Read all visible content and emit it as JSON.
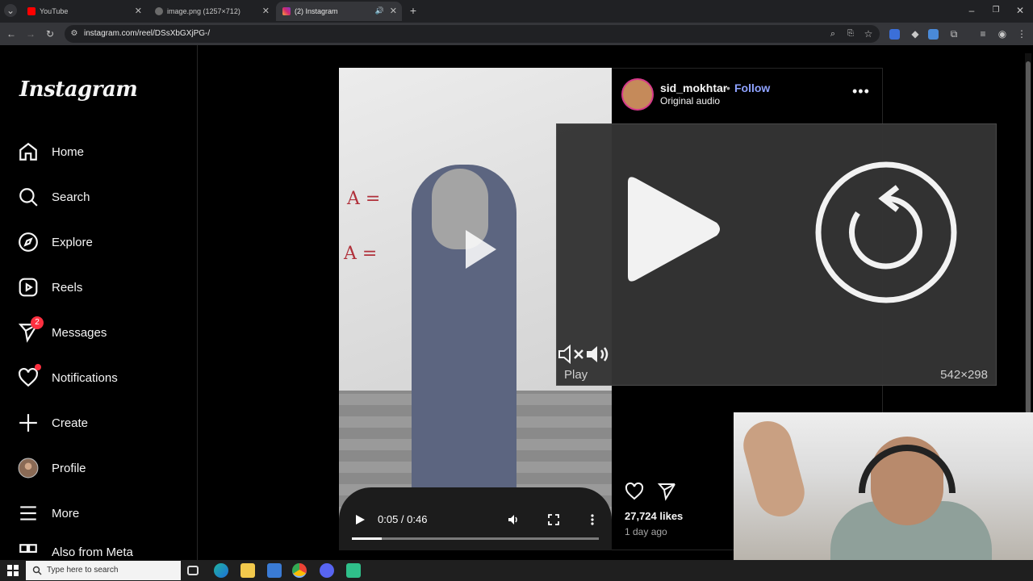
{
  "browser": {
    "tabs": [
      {
        "title": "YouTube",
        "active": false
      },
      {
        "title": "image.png (1257×712)",
        "active": false
      },
      {
        "title": "(2) Instagram",
        "active": true
      }
    ],
    "url": "instagram.com/reel/DSsXbGXjPG-/"
  },
  "sidebar": {
    "logo": "Instagram",
    "items": [
      {
        "label": "Home",
        "icon": "home-icon"
      },
      {
        "label": "Search",
        "icon": "search-icon"
      },
      {
        "label": "Explore",
        "icon": "compass-icon"
      },
      {
        "label": "Reels",
        "icon": "reels-icon"
      },
      {
        "label": "Messages",
        "icon": "messenger-icon",
        "badge": "2"
      },
      {
        "label": "Notifications",
        "icon": "heart-icon"
      },
      {
        "label": "Create",
        "icon": "plus-icon"
      },
      {
        "label": "Profile",
        "icon": "avatar-icon"
      },
      {
        "label": "More",
        "icon": "menu-icon"
      },
      {
        "label": "Also from Meta",
        "icon": "meta-icon"
      }
    ]
  },
  "reel": {
    "username": "sid_mokhtar",
    "follow_label": "Follow",
    "separator": "•",
    "audio": "Original audio",
    "time": "0:05 / 0:46",
    "progress": 0.12,
    "likes": "27,724 likes",
    "posted": "1 day ago",
    "board_text": [
      "A =",
      "A ="
    ]
  },
  "overlay": {
    "label": "Play",
    "dimensions": "542×298"
  },
  "taskbar": {
    "search_placeholder": "Type here to search"
  }
}
